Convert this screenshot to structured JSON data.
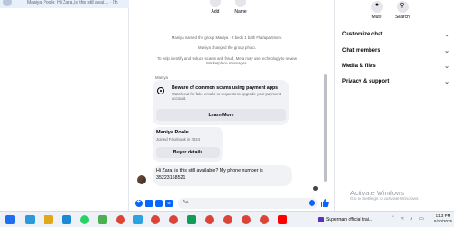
{
  "left_panel": {
    "snippet": "Maniya Poole: Hi Zara, is this still avail... · 2h"
  },
  "chat": {
    "top_actions": [
      {
        "label": "Add",
        "icon": "add-icon"
      },
      {
        "label": "Name",
        "icon": "edit-icon"
      }
    ],
    "system_messages": [
      "Maniya named the group Maniya · 2 beds 1 bath Flat/apartment.",
      "Maniya changed the group photo.",
      "To help identify and reduce scams and fraud, Meta may use technology to review Marketplace messages."
    ],
    "sender_name": "Maniya",
    "scam_card": {
      "title": "Beware of common scams using payment apps",
      "description": "Watch out for fake emails or requests to upgrade your payment account.",
      "button": "Learn More"
    },
    "profile_card": {
      "name": "Maniya Poole",
      "joined": "Joined Facebook in 2024",
      "button": "Buyer details"
    },
    "message": "Hi Zara, is this still available? My phone number is 35223168521",
    "composer": {
      "placeholder": "Aa"
    }
  },
  "right_panel": {
    "actions": [
      {
        "label": "Mute",
        "icon": "bell-icon"
      },
      {
        "label": "Search",
        "icon": "search-icon"
      }
    ],
    "sections": [
      {
        "label": "Customize chat",
        "icon": "chevron-down-icon"
      },
      {
        "label": "Chat members",
        "icon": "chevron-down-icon"
      },
      {
        "label": "Media & files",
        "icon": "chevron-down-icon"
      },
      {
        "label": "Privacy & support",
        "icon": "chevron-down-icon"
      }
    ]
  },
  "watermark": {
    "title": "Activate Windows",
    "subtitle": "Go to Settings to activate Windows."
  },
  "taskbar": {
    "media": "Superman official trai...",
    "time": "1:13 PM",
    "date": "5/20/2025"
  },
  "colors": {
    "accent": "#0866ff",
    "bubble": "#f0f2f5",
    "muted_text": "#65676b"
  }
}
